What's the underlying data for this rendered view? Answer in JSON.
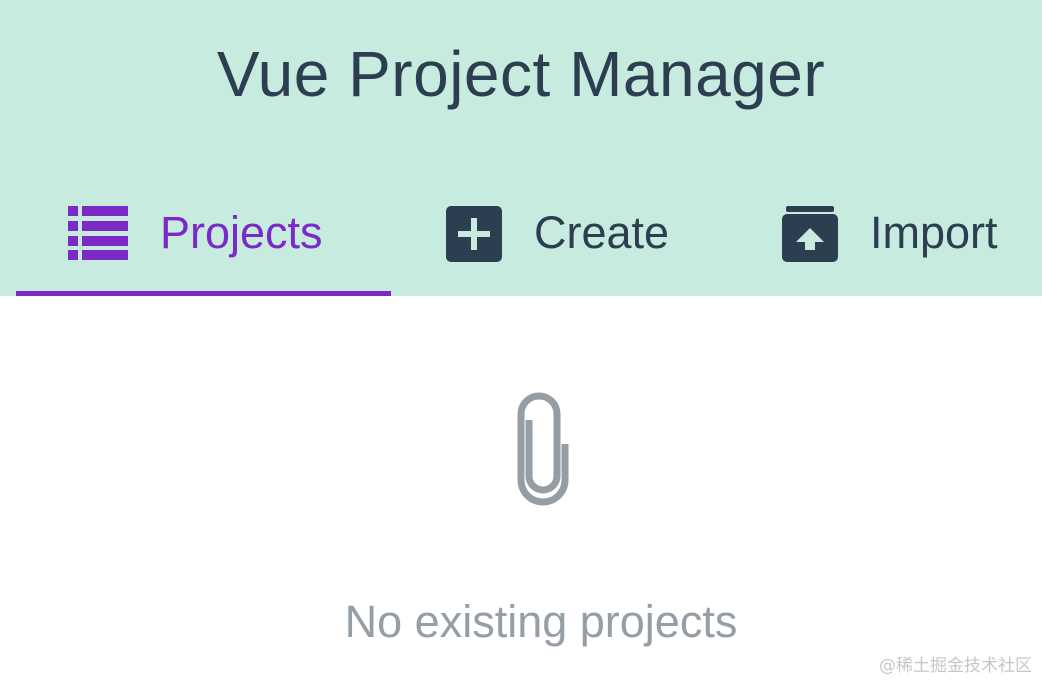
{
  "app": {
    "title": "Vue Project Manager"
  },
  "tabs": [
    {
      "label": "Projects",
      "icon": "list-icon",
      "active": true
    },
    {
      "label": "Create",
      "icon": "plus-box-icon",
      "active": false
    },
    {
      "label": "Import",
      "icon": "upload-box-icon",
      "active": false
    }
  ],
  "empty_state": {
    "icon": "paperclip-icon",
    "message": "No existing projects"
  },
  "watermark": "@稀土掘金技术社区",
  "colors": {
    "header_bg": "#c8ebe0",
    "active_accent": "#7b2ac7",
    "primary_text": "#2c3e50",
    "muted_text": "#969ea5"
  }
}
